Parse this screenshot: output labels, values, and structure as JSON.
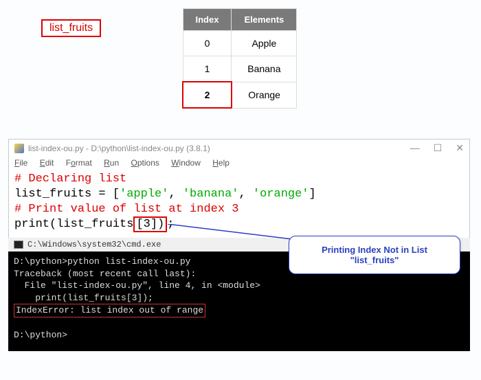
{
  "label": "list_fruits",
  "table": {
    "headers": [
      "Index",
      "Elements"
    ],
    "rows": [
      {
        "index": "0",
        "element": "Apple"
      },
      {
        "index": "1",
        "element": "Banana"
      },
      {
        "index": "2",
        "element": "Orange",
        "highlight_index": true
      }
    ]
  },
  "idle": {
    "title": "list-index-ou.py - D:\\python\\list-index-ou.py (3.8.1)",
    "menu": [
      "File",
      "Edit",
      "Format",
      "Run",
      "Options",
      "Window",
      "Help"
    ],
    "win_buttons": [
      "minimize",
      "maximize",
      "close"
    ],
    "code": {
      "line1_comment": "# Declaring list",
      "line2_var": "list_fruits = [",
      "line2_str1": "'apple'",
      "line2_sep1": ", ",
      "line2_str2": "'banana'",
      "line2_sep2": ", ",
      "line2_str3": "'orange'",
      "line2_end": "]",
      "line3_comment": "# Print value of list at index 3",
      "line4_a": "print(list_fruits",
      "line4_hl": "[3])",
      "line4_b": ";"
    }
  },
  "cmd": {
    "title": "C:\\Windows\\system32\\cmd.exe",
    "lines": {
      "l1": "D:\\python>python list-index-ou.py",
      "l2": "Traceback (most recent call last):",
      "l3": "  File \"list-index-ou.py\", line 4, in <module>",
      "l4": "    print(list_fruits[3]);",
      "err": "IndexError: list index out of range",
      "l6": "",
      "l7": "D:\\python>"
    }
  },
  "callout": "Printing Index Not in List \"list_fruits\""
}
